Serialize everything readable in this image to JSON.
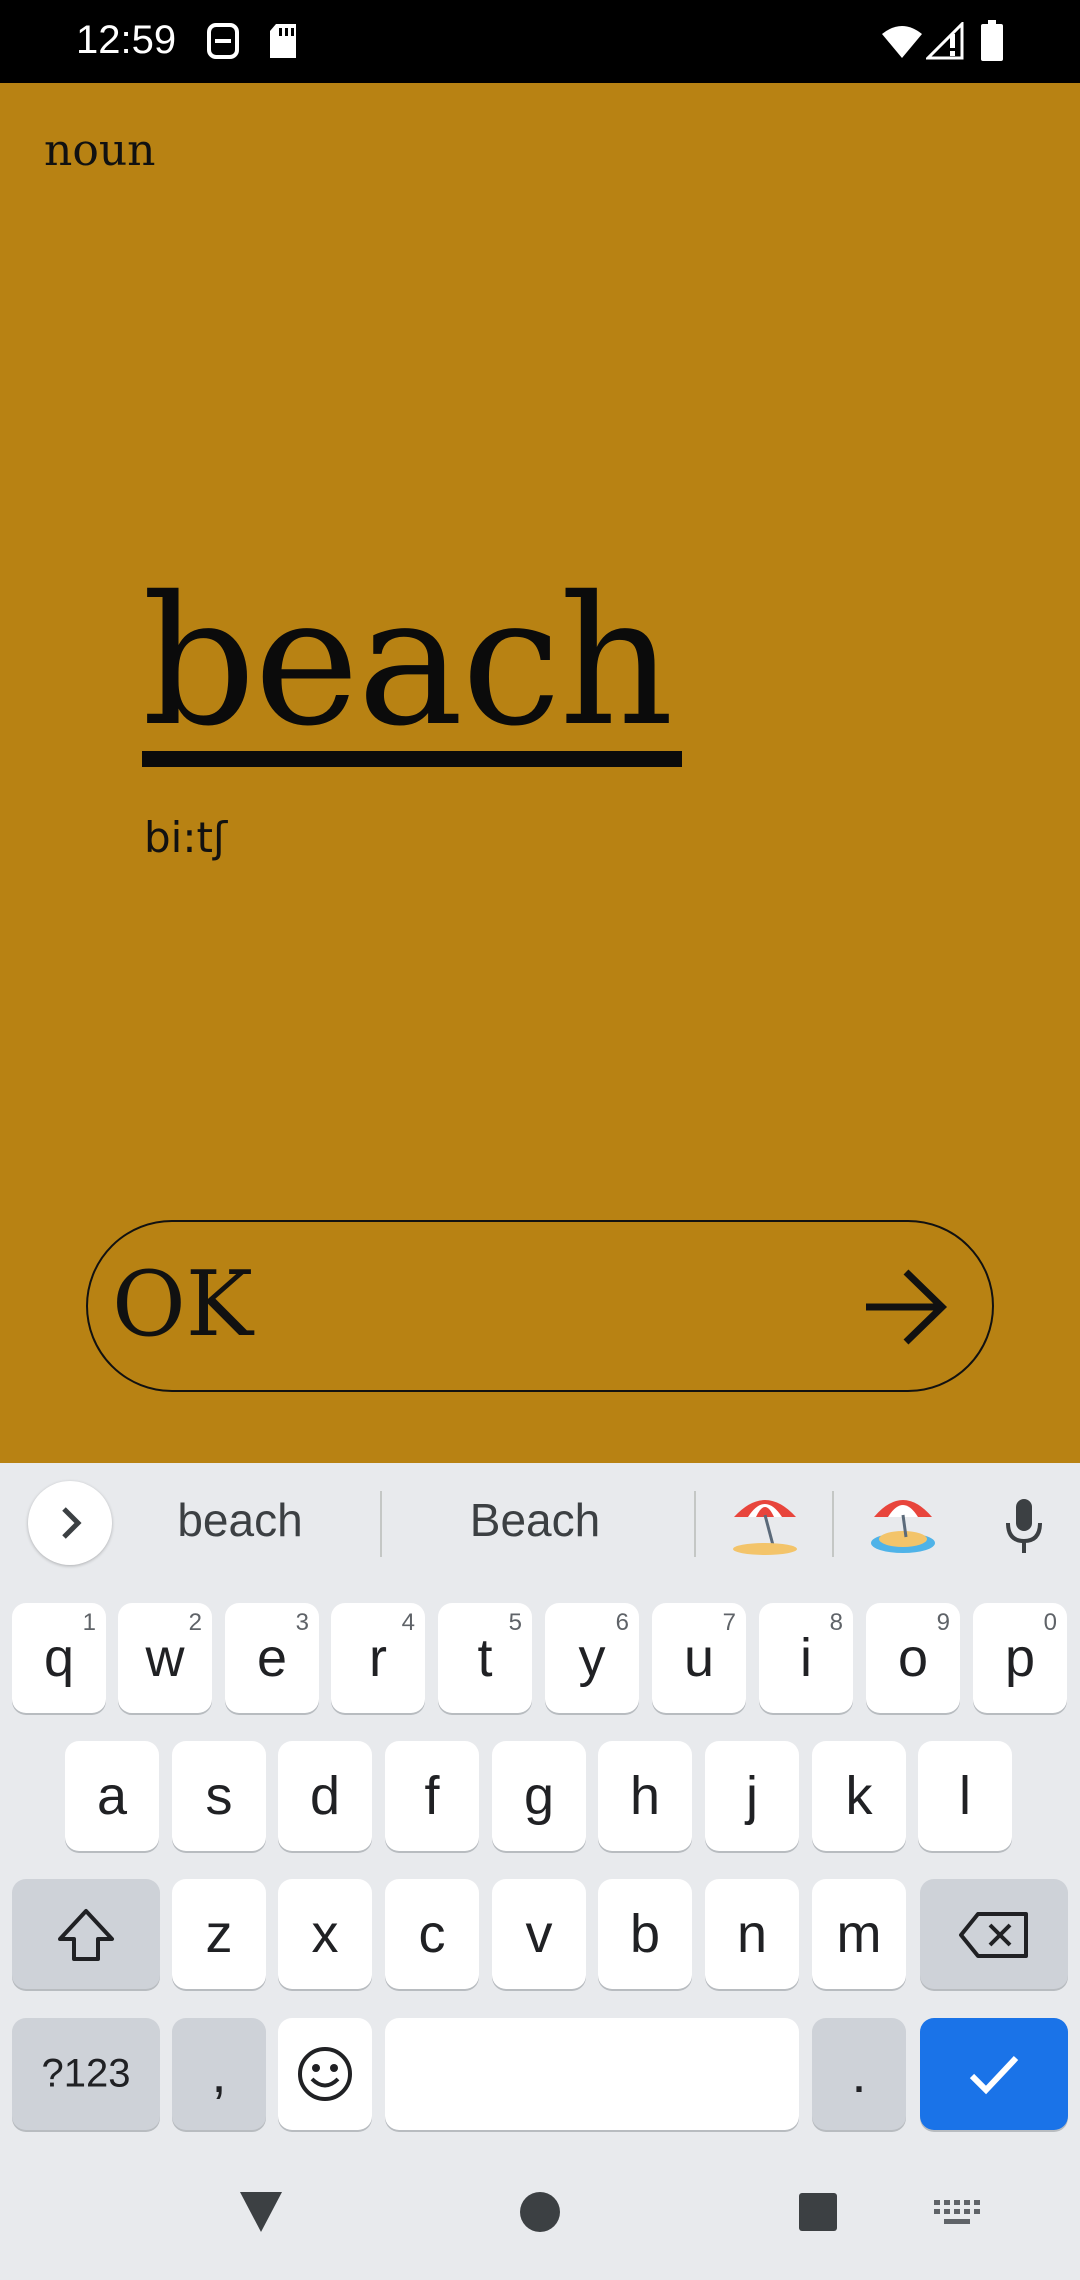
{
  "status_bar": {
    "time": "12:59",
    "left_icons": [
      "screenshot-icon",
      "sd-card-icon"
    ],
    "right_icons": [
      "wifi-icon",
      "signal-icon",
      "battery-icon"
    ]
  },
  "card": {
    "part_of_speech": "noun",
    "word": "beach",
    "phonetic": "bi:tʃ"
  },
  "answer": {
    "value": "OK",
    "submit_icon": "arrow-right-icon"
  },
  "keyboard": {
    "suggestions": [
      "beach",
      "Beach"
    ],
    "emoji_suggestions": [
      "beach-umbrella-emoji",
      "desert-island-emoji"
    ],
    "row1": [
      {
        "k": "q",
        "h": "1"
      },
      {
        "k": "w",
        "h": "2"
      },
      {
        "k": "e",
        "h": "3"
      },
      {
        "k": "r",
        "h": "4"
      },
      {
        "k": "t",
        "h": "5"
      },
      {
        "k": "y",
        "h": "6"
      },
      {
        "k": "u",
        "h": "7"
      },
      {
        "k": "i",
        "h": "8"
      },
      {
        "k": "o",
        "h": "9"
      },
      {
        "k": "p",
        "h": "0"
      }
    ],
    "row2": [
      "a",
      "s",
      "d",
      "f",
      "g",
      "h",
      "j",
      "k",
      "l"
    ],
    "row3": [
      "z",
      "x",
      "c",
      "v",
      "b",
      "n",
      "m"
    ],
    "symbols_label": "?123",
    "comma_label": ",",
    "period_label": ".",
    "accent_color": "#1a73e8"
  },
  "colors": {
    "app_background": "#b88213",
    "keyboard_background": "#e8eaed"
  }
}
